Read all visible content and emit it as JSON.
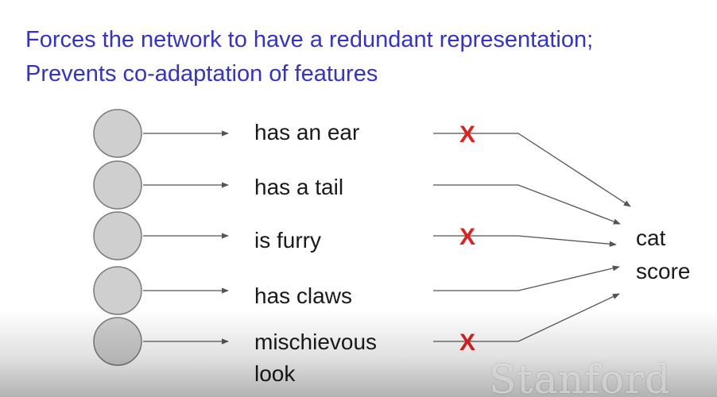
{
  "slide": {
    "title_lines": [
      "Forces the network to have a redundant representation;",
      "Prevents co-adaptation of features"
    ],
    "features": [
      {
        "label": "has an ear",
        "dropped": true
      },
      {
        "label": "has a tail",
        "dropped": false
      },
      {
        "label": "is furry",
        "dropped": true
      },
      {
        "label": "has claws",
        "dropped": false
      },
      {
        "label": "mischievous",
        "label_line2": "look",
        "dropped": true
      }
    ],
    "output": {
      "line1": "cat",
      "line2": "score"
    },
    "drop_mark": "X",
    "watermark": "Stanford"
  },
  "colors": {
    "title": "#3333cc",
    "text": "#1a1a1a",
    "neuron_fill": "#cfcfcf",
    "neuron_stroke": "#7a7a7a",
    "arrow": "#555555",
    "drop_mark": "#e02020"
  }
}
